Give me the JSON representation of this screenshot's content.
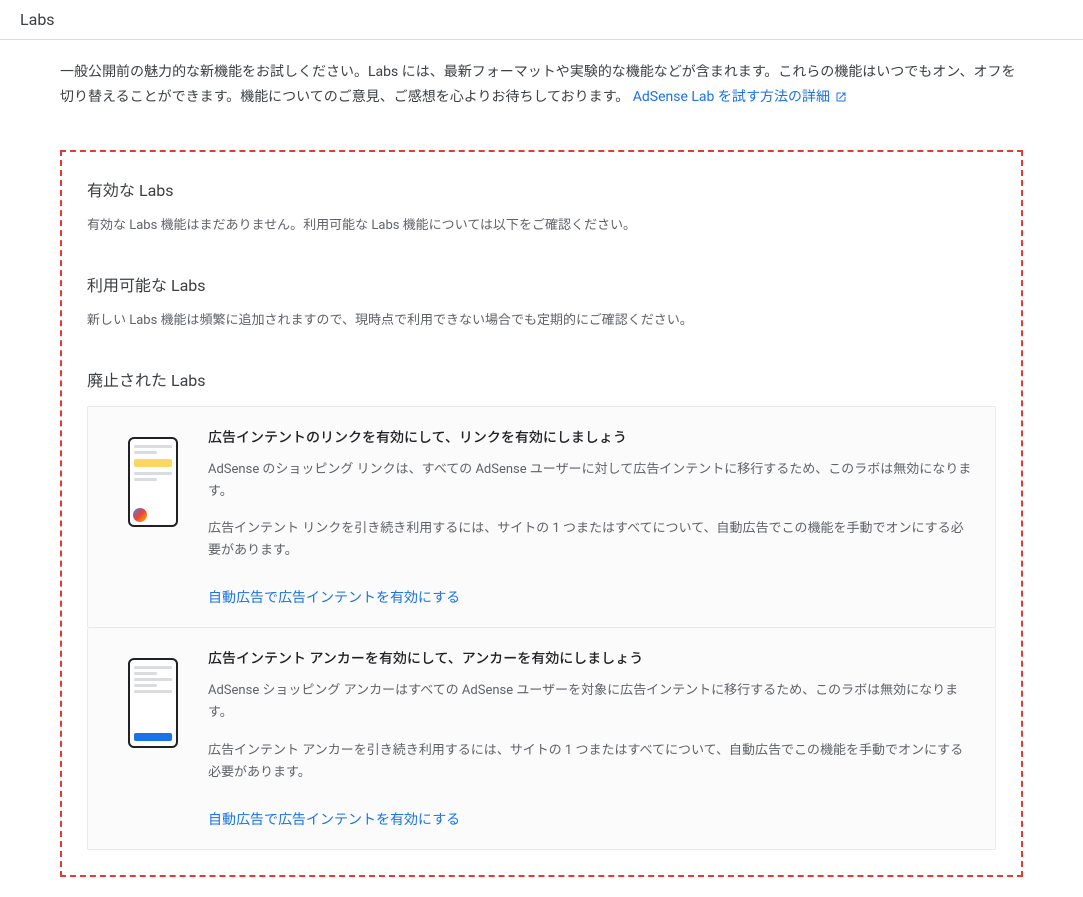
{
  "header": {
    "title": "Labs"
  },
  "intro": {
    "text": "一般公開前の魅力的な新機能をお試しください。Labs には、最新フォーマットや実験的な機能などが含まれます。これらの機能はいつでもオン、オフを切り替えることができます。機能についてのご意見、ご感想を心よりお待ちしております。",
    "link_text": "AdSense Lab を試す方法の詳細"
  },
  "sections": {
    "enabled": {
      "heading": "有効な Labs",
      "text": "有効な Labs 機能はまだありません。利用可能な Labs 機能については以下をご確認ください。"
    },
    "available": {
      "heading": "利用可能な Labs",
      "text": "新しい Labs 機能は頻繁に追加されますので、現時点で利用できない場合でも定期的にご確認ください。"
    },
    "retired": {
      "heading": "廃止された Labs"
    }
  },
  "cards": [
    {
      "title": "広告インテントのリンクを有効にして、リンクを有効にしましょう",
      "desc1": "AdSense のショッピング リンクは、すべての AdSense ユーザーに対して広告インテントに移行するため、このラボは無効になります。",
      "desc2": "広告インテント リンクを引き続き利用するには、サイトの 1 つまたはすべてについて、自動広告でこの機能を手動でオンにする必要があります。",
      "link": "自動広告で広告インテントを有効にする"
    },
    {
      "title": "広告インテント アンカーを有効にして、アンカーを有効にしましょう",
      "desc1": "AdSense ショッピング アンカーはすべての AdSense ユーザーを対象に広告インテントに移行するため、このラボは無効になります。",
      "desc2": "広告インテント アンカーを引き続き利用するには、サイトの 1 つまたはすべてについて、自動広告でこの機能を手動でオンにする必要があります。",
      "link": "自動広告で広告インテントを有効にする"
    }
  ]
}
